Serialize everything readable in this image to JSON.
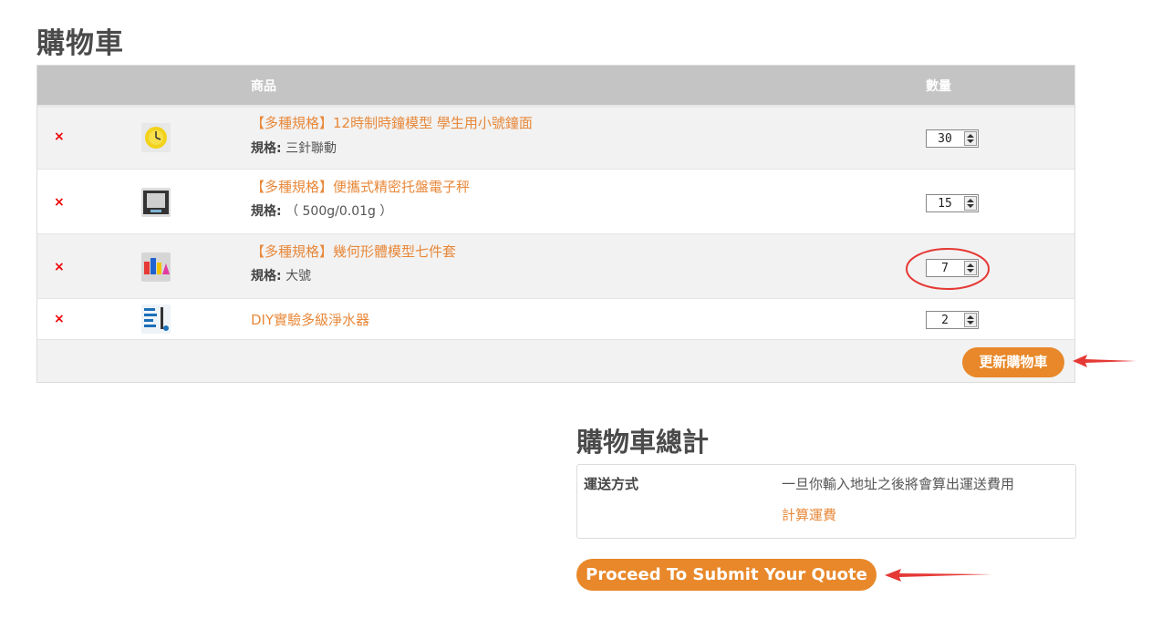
{
  "page": {
    "title": "購物車"
  },
  "table": {
    "headers": {
      "product": "商品",
      "quantity": "數量"
    },
    "remove_symbol": "×",
    "items": [
      {
        "name": "【多種規格】12時制時鐘模型 學生用小號鐘面",
        "spec_label": "規格:",
        "spec_value": "三針聯動",
        "quantity": "30",
        "thumb": "yellow-clock-thumbnail"
      },
      {
        "name": "【多種規格】便攜式精密托盤電子秤",
        "spec_label": "規格:",
        "spec_value": "（ 500g/0.01g ）",
        "quantity": "15",
        "thumb": "digital-scale-thumbnail"
      },
      {
        "name": "【多種規格】幾何形體模型七件套",
        "spec_label": "規格:",
        "spec_value": "大號",
        "quantity": "7",
        "thumb": "geometry-blocks-thumbnail"
      },
      {
        "name": "DIY實驗多級淨水器",
        "quantity": "2",
        "thumb": "water-purifier-thumbnail"
      }
    ],
    "update_button": "更新購物車"
  },
  "totals": {
    "title": "購物車總計",
    "shipping_label": "運送方式",
    "shipping_note": "一旦你輸入地址之後將會算出運送費用",
    "calculate_link": "計算運費"
  },
  "submit_button": "Proceed To Submit Your Quote",
  "colors": {
    "accent": "#e8882a",
    "link": "#e8883a",
    "remove": "#ee0000",
    "annotation": "#e53935",
    "header": "#c4c4c4"
  }
}
